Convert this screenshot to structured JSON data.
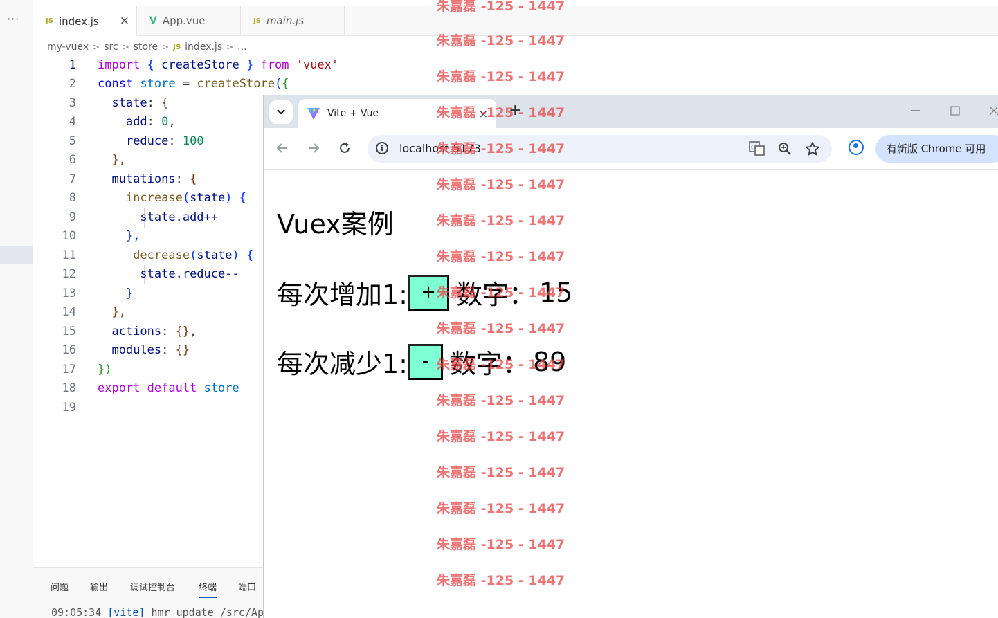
{
  "vscode": {
    "more_label": "···",
    "tabs": [
      {
        "icon": "JS",
        "label": "index.js",
        "close": "×"
      },
      {
        "icon": "V",
        "label": "App.vue"
      },
      {
        "icon": "JS",
        "label": "main.js"
      }
    ],
    "breadcrumb": [
      "my-vuex",
      "src",
      "store",
      "index.js",
      "..."
    ],
    "breadcrumb_file_icon": "JS",
    "breadcrumb_sep": ">",
    "line_numbers": [
      "1",
      "2",
      "3",
      "4",
      "5",
      "6",
      "7",
      "8",
      "9",
      "10",
      "11",
      "12",
      "13",
      "14",
      "15",
      "16",
      "17",
      "18",
      "19"
    ],
    "code": {
      "l1": {
        "kw_import": "import",
        "b_open": "{",
        "fn": "createStore",
        "b_close": "}",
        "kw_from": "from",
        "str": "'vuex'"
      },
      "l2": {
        "kw_const": "const",
        "var": "store",
        "eq": "=",
        "fn": "createStore",
        "paren": "(",
        "brace": "{"
      },
      "l3": {
        "key": "state",
        "colon": ":",
        "brace": "{"
      },
      "l4": {
        "key": "add",
        "colon": ":",
        "num": "0",
        "comma": ","
      },
      "l5": {
        "key": "reduce",
        "colon": ":",
        "num": "100"
      },
      "l6": {
        "text": "},"
      },
      "l7": {
        "key": "mutations",
        "colon": ":",
        "brace": "{"
      },
      "l8": {
        "fn": "increase",
        "paren_open": "(",
        "param": "state",
        "paren_close": ")",
        "brace": "{"
      },
      "l9": {
        "text": "state.add++"
      },
      "l10": {
        "text": "},"
      },
      "l11": {
        "fn": "decrease",
        "paren_open": "(",
        "param": "state",
        "paren_close": ")",
        "brace": "{"
      },
      "l12": {
        "text": "state.reduce--"
      },
      "l13": {
        "text": "}"
      },
      "l14": {
        "text": "},"
      },
      "l15": {
        "key": "actions",
        "colon": ":",
        "val": "{}",
        "comma": ","
      },
      "l16": {
        "key": "modules",
        "colon": ":",
        "val": "{}"
      },
      "l17": {
        "text": "})"
      },
      "l18": {
        "kw_export": "export",
        "kw_default": "default",
        "var": "store"
      }
    },
    "panel_tabs": [
      "问题",
      "输出",
      "调试控制台",
      "终端",
      "端口"
    ],
    "active_panel_tab": "终端",
    "terminal": {
      "time": "09:05:34",
      "tag": "[vite]",
      "msg": "hmr update",
      "path": "/src/Ap"
    }
  },
  "browser": {
    "tab_title": "Vite + Vue",
    "tab_close": "×",
    "new_tab": "+",
    "url": "localhost:5173",
    "update_label": "有新版 Chrome 可用",
    "icons": [
      "back-icon",
      "forward-icon",
      "reload-icon",
      "site-info-icon",
      "translate-icon",
      "zoom-icon",
      "bookmark-star-icon",
      "profile-icon",
      "menu-icon"
    ]
  },
  "page": {
    "title": "Vuex案例",
    "row1": {
      "label": "每次增加1:",
      "button": "+",
      "num_label": "数字：",
      "value": "15"
    },
    "row2": {
      "label": "每次减少1:",
      "button": "-",
      "num_label": "数字：",
      "value": "89"
    }
  },
  "watermark": {
    "text": "朱嘉磊 -125 - 1447"
  },
  "colors": {
    "button_bg": "#7fffd4",
    "watermark": "#e64646",
    "vscode_accent": "#005fb8"
  }
}
